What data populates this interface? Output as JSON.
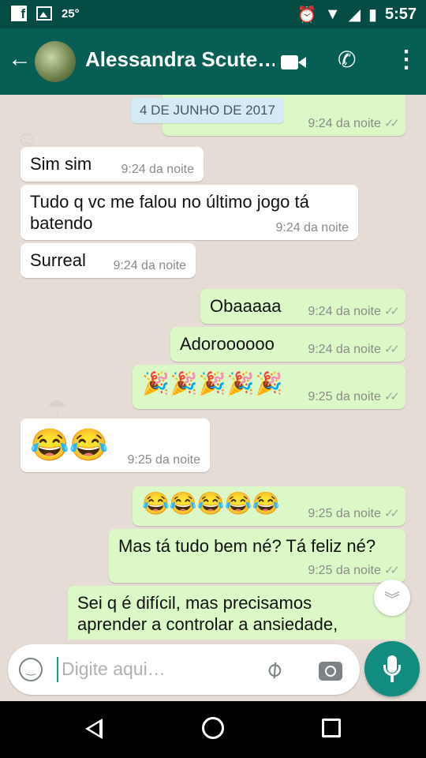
{
  "status_bar": {
    "temperature": "25°",
    "time": "5:57",
    "icons": [
      "facebook-icon",
      "image-icon",
      "alarm-icon",
      "wifi-icon",
      "signal-icon",
      "battery-icon"
    ]
  },
  "header": {
    "contact_name": "Alessandra Scute…",
    "icons": [
      "back-arrow-icon",
      "avatar",
      "video-call-icon",
      "phone-icon",
      "more-options-icon"
    ]
  },
  "chat": {
    "date_chip": "4 DE JUNHO DE 2017",
    "messages": [
      {
        "dir": "out",
        "text": "",
        "time": "9:24 da noite",
        "read": true
      },
      {
        "dir": "in",
        "text": "Sim sim",
        "time": "9:24 da noite"
      },
      {
        "dir": "in",
        "text": "Tudo q vc me falou no último jogo tá batendo",
        "time": "9:24 da noite"
      },
      {
        "dir": "in",
        "text": "Surreal",
        "time": "9:24 da noite"
      },
      {
        "dir": "out",
        "text": "Obaaaaa",
        "time": "9:24 da noite",
        "read": true
      },
      {
        "dir": "out",
        "text": "Adoroooooo",
        "time": "9:24 da noite",
        "read": true
      },
      {
        "dir": "out",
        "text": "🎉🎉🎉🎉🎉",
        "time": "9:25 da noite",
        "read": true
      },
      {
        "dir": "in",
        "text": "😂😂",
        "time": "9:25 da noite"
      },
      {
        "dir": "out",
        "text": "😂😂😂😂😂",
        "time": "9:25 da noite",
        "read": true
      },
      {
        "dir": "out",
        "text": "Mas tá tudo bem né? Tá feliz né?",
        "time": "9:25 da noite",
        "read": true
      },
      {
        "dir": "out",
        "text": "Sei q é difícil, mas precisamos aprender a controlar a ansiedade,",
        "time": "",
        "read": false
      }
    ],
    "scroll_down_icon": "double-chevron-down-icon"
  },
  "composer": {
    "placeholder": "Digite aqui…",
    "icons": [
      "emoji-icon",
      "attach-icon",
      "camera-icon",
      "mic-icon"
    ]
  },
  "nav_bar": {
    "icons": [
      "nav-back-icon",
      "nav-home-icon",
      "nav-recents-icon"
    ]
  },
  "colors": {
    "header": "#075e54",
    "status_bar": "#054d44",
    "outgoing_bubble": "#dcf8c6",
    "incoming_bubble": "#ffffff",
    "chat_background": "#e5ddd5",
    "mic_button": "#128c7e",
    "date_chip": "#d4eaf4"
  }
}
